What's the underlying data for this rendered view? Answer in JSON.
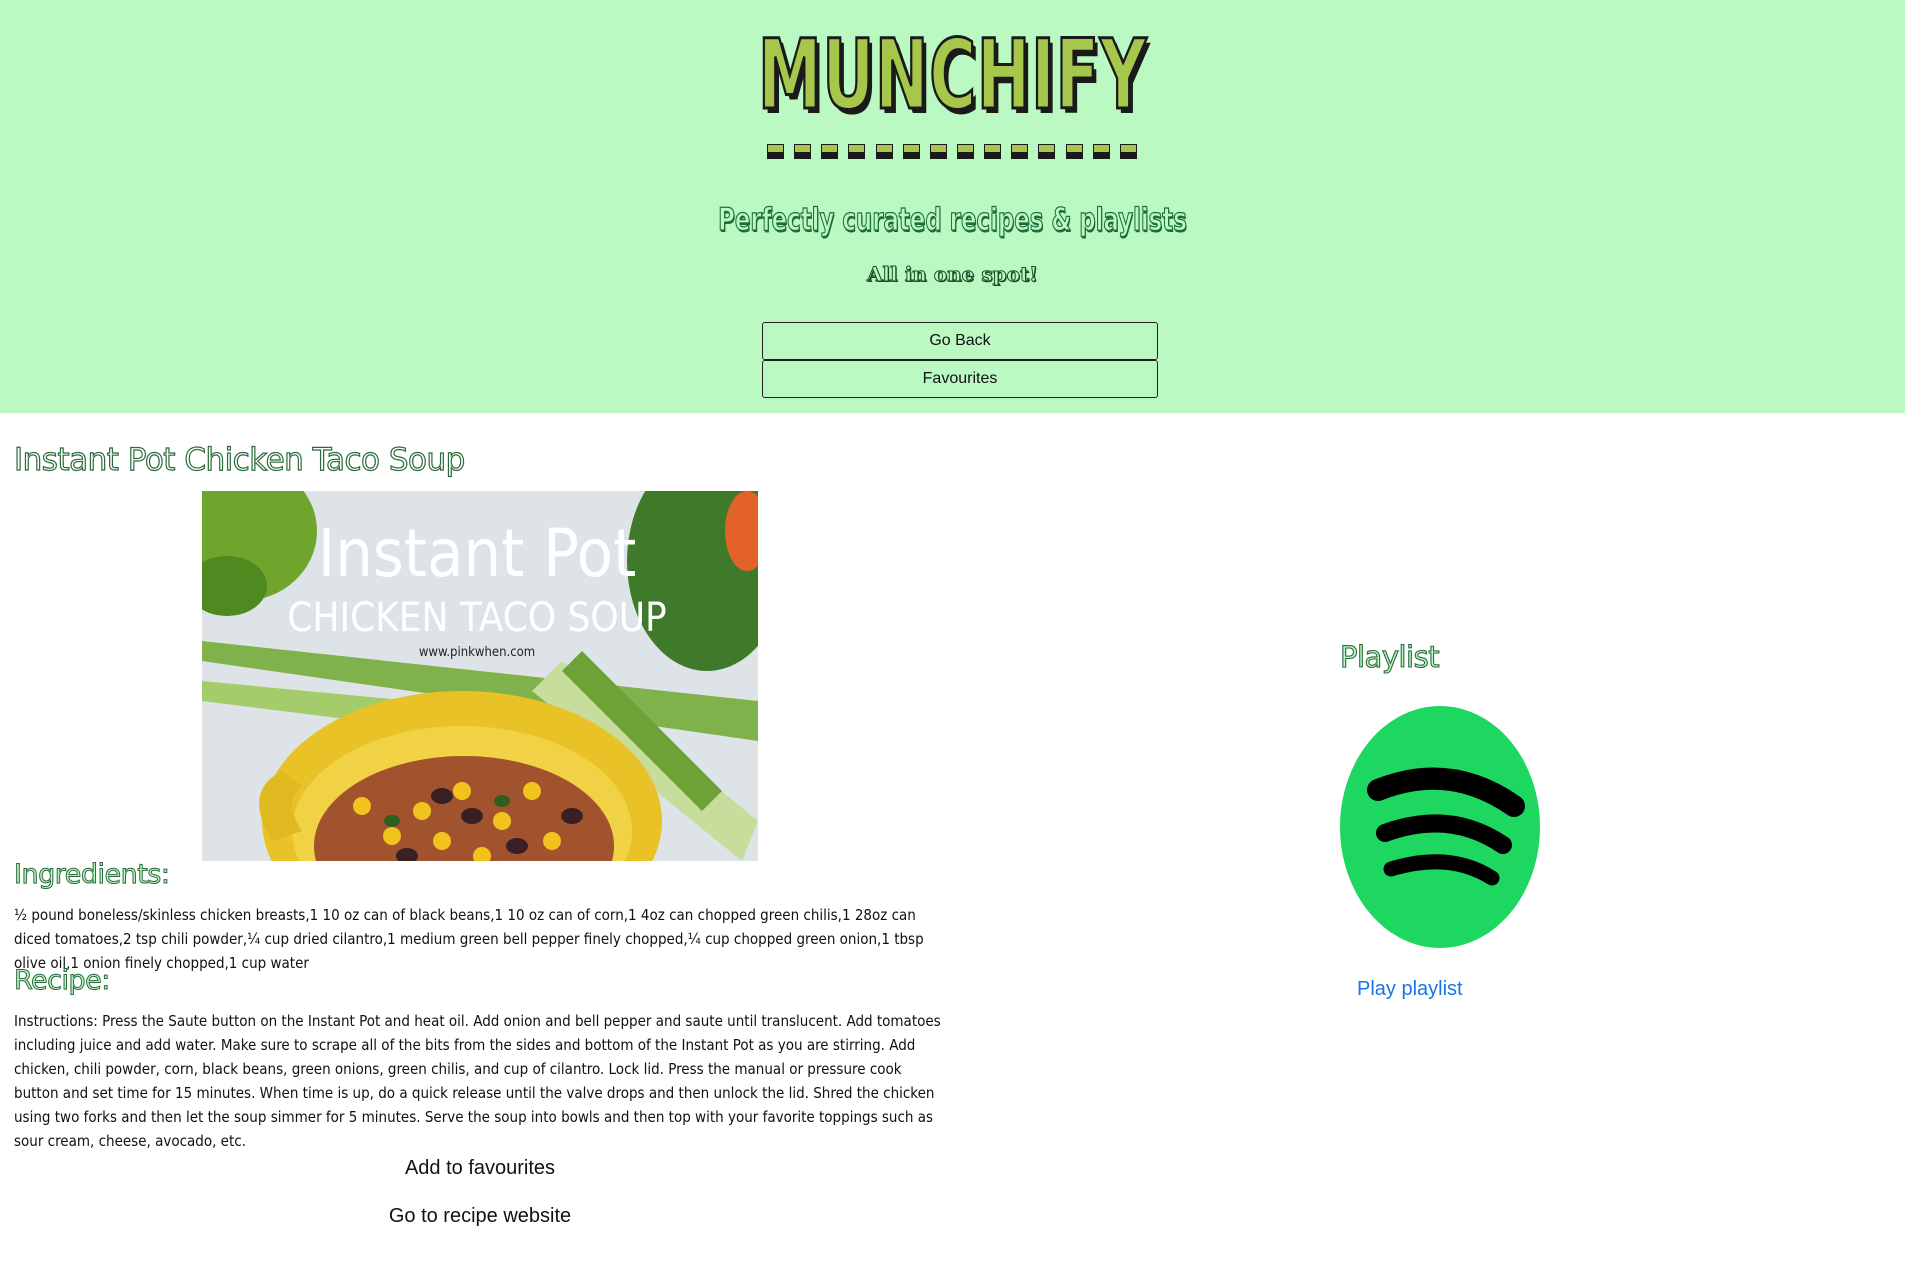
{
  "header": {
    "logo_text": "MUNCHIFY",
    "tagline": "Perfectly curated recipes & playlists",
    "sub_tagline": "All in one spot!",
    "go_back_label": "Go Back",
    "favourites_label": "Favourites",
    "colors": {
      "background": "#bbf9c2",
      "logo": "#a6c64c"
    }
  },
  "recipe": {
    "title": "Instant Pot Chicken Taco Soup",
    "image": {
      "headline": "Instant Pot",
      "subheadline": "CHICKEN TACO SOUP",
      "credit": "www.pinkwhen.com"
    },
    "ingredients_heading": "Ingredients:",
    "ingredients_text": "½ pound boneless/skinless chicken breasts,1 10 oz can of black beans,1 10 oz can of corn,1 4oz can chopped green chilis,1 28oz can diced tomatoes,2 tsp chili powder,¼ cup dried cilantro,1 medium green bell pepper finely chopped,¼ cup chopped green onion,1 tbsp olive oil,1 onion finely chopped,1 cup water",
    "recipe_heading": "Recipe:",
    "instructions_text": "Instructions: Press the Saute button on the Instant Pot and heat oil. Add onion and bell pepper and saute until translucent. Add tomatoes including juice and add water. Make sure to scrape all of the bits from the sides and bottom of the Instant Pot as you are stirring. Add chicken, chili powder, corn, black beans, green onions, green chilis, and cup of cilantro. Lock lid. Press the manual or pressure cook button and set time for 15 minutes. When time is up, do a quick release until the valve drops and then unlock the lid. Shred the chicken using two forks and then let the soup simmer for 5 minutes. Serve the soup into bowls and then top with your favorite toppings such as sour cream, cheese, avocado, etc.",
    "add_favourites_label": "Add to favourites",
    "website_label": "Go to recipe website"
  },
  "playlist": {
    "heading": "Playlist",
    "logo_icon": "spotify-icon",
    "play_label": "Play playlist",
    "colors": {
      "spotify_green": "#1ed760",
      "link": "#1a73e8"
    }
  }
}
